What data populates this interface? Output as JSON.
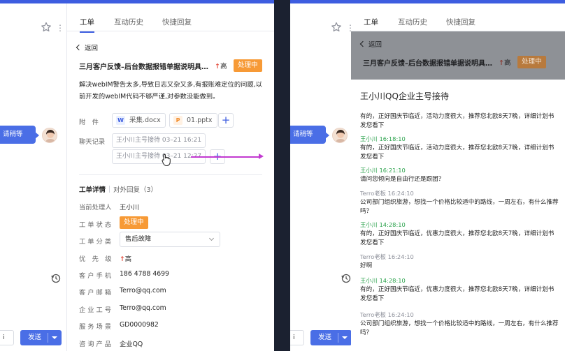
{
  "left_strip": {
    "bubble_text": "请稍等",
    "input_text": "i",
    "send_label": "发送"
  },
  "ticket": {
    "tabs": [
      "工单",
      "互动历史",
      "快捷回复"
    ],
    "back_label": "返回",
    "title": "三月客户反馈–后台数据报错单据说明具…",
    "priority_arrow": "↑",
    "priority": "高",
    "status": "处理中",
    "description": "解决webIM警告太多,导致日志又杂又多,有报账难定位的问题,以前开发的webIM代码不够严谨,对参数没能做到。",
    "attachments_label": "附　件",
    "attachments": [
      {
        "icon": "W",
        "name": "采集.docx"
      },
      {
        "icon": "P",
        "name": "01.pptx"
      }
    ],
    "chat_records_label": "聊天记录",
    "chat_records": [
      "王小川主号接待 03–21 16:21",
      "王小川主号接待 03–21 12:27"
    ],
    "detail_tab": "工单详情",
    "reply_tab": "对外回复（3）",
    "fields": [
      {
        "label": "当前处理人",
        "value": "王小川"
      },
      {
        "label": "工 单 状 态",
        "value": "处理中"
      },
      {
        "label": "工 单 分 类",
        "value": "售后故障"
      },
      {
        "label": "优　先　级",
        "value": "高"
      },
      {
        "label": "客 户 手 机",
        "value": "186 4788 4699"
      },
      {
        "label": "客 户 邮 箱",
        "value": "Terro@qq.com"
      },
      {
        "label": "企 业 工 号",
        "value": "Terro@qq.com"
      },
      {
        "label": "服 务 场 景",
        "value": "GD0000982"
      },
      {
        "label": "咨 询 产 品",
        "value": "企业QQ"
      }
    ]
  },
  "chat_detail": {
    "title": "王小川QQ企业主号接待",
    "messages": [
      {
        "who": "",
        "color": "none",
        "text": "有的，正好国庆节临近，活动力度很大，推荐您北欧8天7晚，详细计划书发您看下"
      },
      {
        "who": "王小川 16:18:10",
        "color": "green",
        "text": "有的，正好国庆节临近，活动力度很大，推荐您北欧8天7晚，详细计划书发您看下"
      },
      {
        "who": "王小川 16:21:10",
        "color": "green",
        "text": "请问您倾向是自由行还是跟团？"
      },
      {
        "who": "Terro老板 16:24:10",
        "color": "grey",
        "text": "公司部门组织旅游，想找一个价格比较适中的路线，一周左右，有什么推荐吗？"
      },
      {
        "who": "王小川 14:28:10",
        "color": "green",
        "text": "有的，正好国庆节临近，优惠力度很大，推荐您北欧8天7晚，详细计划书发您看下"
      },
      {
        "who": "Terro老板 16:24:10",
        "color": "grey",
        "text": "好啊"
      },
      {
        "who": "王小川 14:28:10",
        "color": "green",
        "text": "有的，正好国庆节临近，优惠力度很大，推荐您北欧8天7晚，详细计划书发您看下"
      },
      {
        "who": "Terro老板 16:24:10",
        "color": "grey",
        "text": "公司部门组织旅游，想找一个价格比较适中的路线，一周左右，有什么推荐吗？"
      }
    ]
  },
  "colors": {
    "accent": "#3d5de0",
    "status_orange": "#f79a36",
    "priority_red": "#e34b3c",
    "sender_green": "#2ba24c"
  }
}
